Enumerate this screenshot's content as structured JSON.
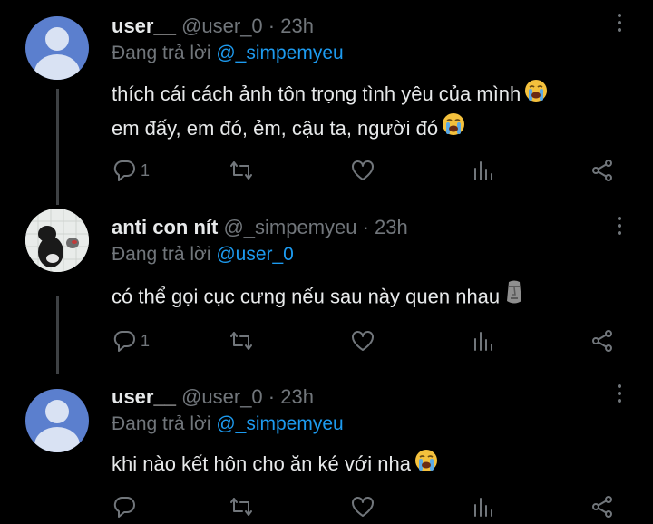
{
  "tweets": [
    {
      "display_name": "user__",
      "handle_time": " @user_0 · 23h",
      "reply_prefix": "Đang trả lời ",
      "reply_handle": "@_simpemyeu",
      "text_line1": "thích cái cách ảnh tôn trọng tình yêu của mình",
      "text_line2": "em đấy, em đó, ẻm, cậu ta, người đó",
      "reply_count": "1",
      "emoji": "loudly-crying-face"
    },
    {
      "display_name": "anti con nít",
      "handle_time": " @_simpemyeu · 23h",
      "reply_prefix": "Đang trả lời ",
      "reply_handle": "@user_0",
      "text_line1": "có thể gọi cục cưng nếu sau này quen nhau",
      "reply_count": "1",
      "emoji": "moai"
    },
    {
      "display_name": "user__",
      "handle_time": " @user_0 · 23h",
      "reply_prefix": "Đang trả lời ",
      "reply_handle": "@_simpemyeu",
      "text_line1": "khi nào kết hôn cho ăn ké với nha",
      "reply_count": "",
      "emoji": "loudly-crying-face"
    }
  ],
  "colors": {
    "background": "#000000",
    "text": "#e7e9ea",
    "muted": "#71767b",
    "link": "#1d9bf0",
    "thread_line": "#3e4144"
  }
}
